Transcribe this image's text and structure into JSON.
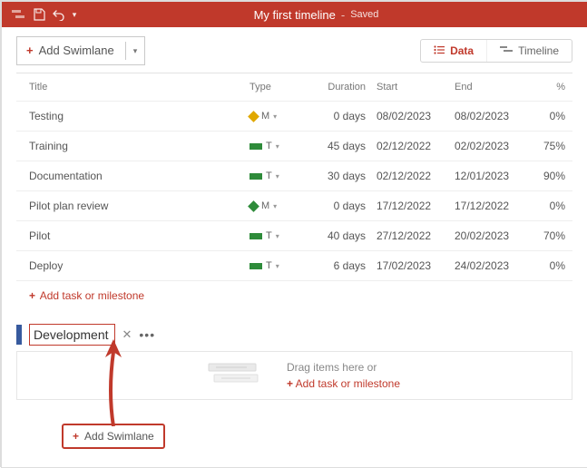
{
  "header": {
    "title": "My first timeline",
    "state": "Saved"
  },
  "toolbar": {
    "add_swimlane": "Add Swimlane",
    "view": {
      "data": "Data",
      "timeline": "Timeline"
    }
  },
  "columns": {
    "title": "Title",
    "type": "Type",
    "duration": "Duration",
    "start": "Start",
    "end": "End",
    "percent": "%"
  },
  "rows": [
    {
      "title": "Testing",
      "shape": "diamond-y",
      "type_letter": "M",
      "duration": "0 days",
      "start": "08/02/2023",
      "end": "08/02/2023",
      "percent": "0%"
    },
    {
      "title": "Training",
      "shape": "bar-g",
      "type_letter": "T",
      "duration": "45 days",
      "start": "02/12/2022",
      "end": "02/02/2023",
      "percent": "75%"
    },
    {
      "title": "Documentation",
      "shape": "bar-g",
      "type_letter": "T",
      "duration": "30 days",
      "start": "02/12/2022",
      "end": "12/01/2023",
      "percent": "90%"
    },
    {
      "title": "Pilot plan review",
      "shape": "diamond-g",
      "type_letter": "M",
      "duration": "0 days",
      "start": "17/12/2022",
      "end": "17/12/2022",
      "percent": "0%"
    },
    {
      "title": "Pilot",
      "shape": "bar-g",
      "type_letter": "T",
      "duration": "40 days",
      "start": "27/12/2022",
      "end": "20/02/2023",
      "percent": "70%"
    },
    {
      "title": "Deploy",
      "shape": "bar-g",
      "type_letter": "T",
      "duration": "6 days",
      "start": "17/02/2023",
      "end": "24/02/2023",
      "percent": "0%"
    }
  ],
  "add_task": "Add task or milestone",
  "swimlane": {
    "name": "Development",
    "drop_hint": "Drag items here or",
    "drop_add": "Add task or milestone"
  },
  "bottom_add": "Add Swimlane"
}
